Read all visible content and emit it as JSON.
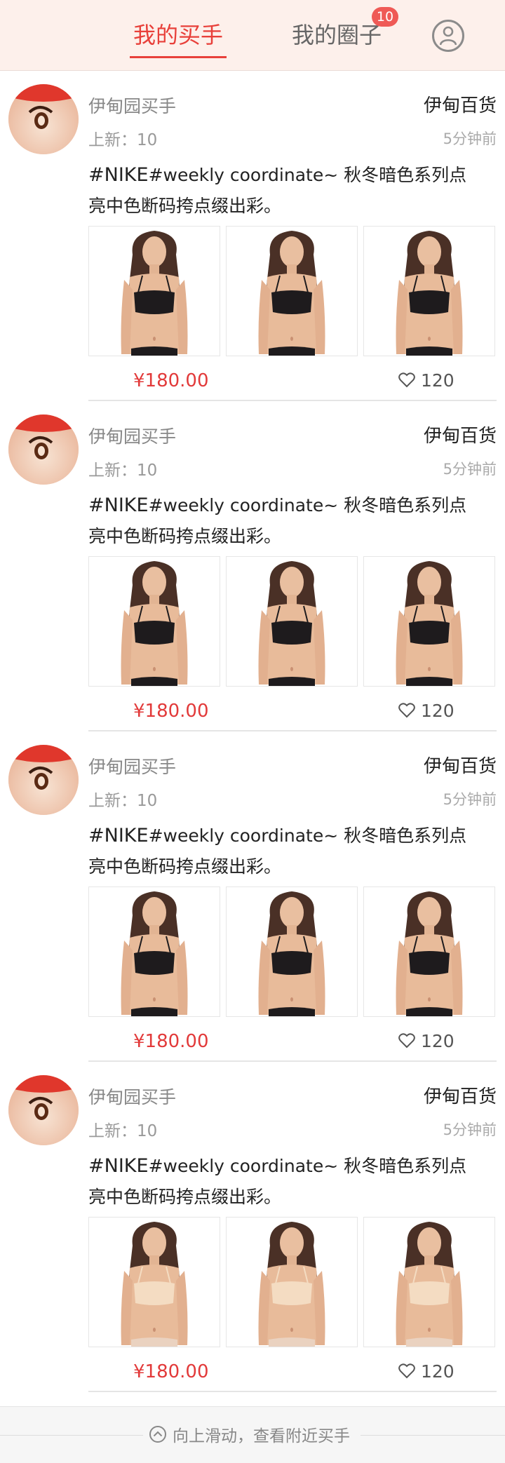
{
  "header": {
    "tab_buyers": "我的买手",
    "tab_circle": "我的圈子",
    "circle_badge": "10",
    "icons": {
      "profile": "user-profile-icon"
    },
    "accent_color": "#e8403a"
  },
  "posts": [
    {
      "buyer": "伊甸园买手",
      "store": "伊甸百货",
      "new_label": "上新：10",
      "time": "5分钟前",
      "tag": "#NIKE",
      "text": "#weekly coordinate~ 秋冬暗色系列点亮中色断码挎点缀出彩。",
      "price": "¥180.00",
      "likes": "120",
      "outfit": "black"
    },
    {
      "buyer": "伊甸园买手",
      "store": "伊甸百货",
      "new_label": "上新：10",
      "time": "5分钟前",
      "tag": "#NIKE",
      "text": "#weekly coordinate~ 秋冬暗色系列点亮中色断码挎点缀出彩。",
      "price": "¥180.00",
      "likes": "120",
      "outfit": "black"
    },
    {
      "buyer": "伊甸园买手",
      "store": "伊甸百货",
      "new_label": "上新：10",
      "time": "5分钟前",
      "tag": "#NIKE",
      "text": "#weekly coordinate~ 秋冬暗色系列点亮中色断码挎点缀出彩。",
      "price": "¥180.00",
      "likes": "120",
      "outfit": "black"
    },
    {
      "buyer": "伊甸园买手",
      "store": "伊甸百货",
      "new_label": "上新：10",
      "time": "5分钟前",
      "tag": "#NIKE",
      "text": "#weekly coordinate~ 秋冬暗色系列点亮中色断码挎点缀出彩。",
      "price": "¥180.00",
      "likes": "120",
      "outfit": "nude"
    }
  ],
  "footer": {
    "hint": "向上滑动，查看附近买手",
    "icon": "chevron-up-circle-icon"
  }
}
